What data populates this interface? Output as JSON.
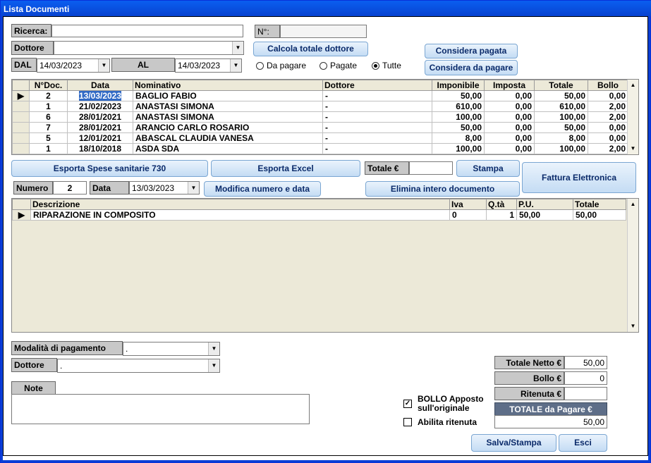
{
  "window": {
    "title": "Lista Documenti"
  },
  "search": {
    "ricerca_label": "Ricerca:",
    "ricerca_value": "",
    "numero_label": "N°:",
    "numero_value": "",
    "dottore_label": "Dottore",
    "dottore_value": "",
    "dal_label": "DAL",
    "dal_value": "14/03/2023",
    "al_label": "AL",
    "al_value": "14/03/2023"
  },
  "buttons": {
    "calcola": "Calcola totale dottore",
    "considera_pagata": "Considera pagata",
    "considera_da_pagare": "Considera da pagare",
    "esporta_730": "Esporta Spese sanitarie 730",
    "esporta_excel": "Esporta Excel",
    "stampa": "Stampa",
    "fattura": "Fattura Elettronica",
    "modifica": "Modifica numero e data",
    "elimina": "Elimina intero documento",
    "salva": "Salva/Stampa",
    "esci": "Esci"
  },
  "filter": {
    "options": [
      "Da pagare",
      "Pagate",
      "Tutte"
    ],
    "selected": "Tutte"
  },
  "docs": {
    "headers": [
      "N°Doc.",
      "Data",
      "Nominativo",
      "Dottore",
      "Imponibile",
      "Imposta",
      "Totale",
      "Bollo"
    ],
    "rows": [
      [
        "2",
        "13/03/2023",
        "BAGLIO FABIO",
        "-",
        "50,00",
        "0,00",
        "50,00",
        "0,00"
      ],
      [
        "1",
        "21/02/2023",
        "ANASTASI SIMONA",
        "-",
        "610,00",
        "0,00",
        "610,00",
        "2,00"
      ],
      [
        "6",
        "28/01/2021",
        "ANASTASI SIMONA",
        "-",
        "100,00",
        "0,00",
        "100,00",
        "2,00"
      ],
      [
        "7",
        "28/01/2021",
        "ARANCIO CARLO ROSARIO",
        "-",
        "50,00",
        "0,00",
        "50,00",
        "0,00"
      ],
      [
        "5",
        "12/01/2021",
        "ABASCAL CLAUDIA VANESA",
        "-",
        "8,00",
        "0,00",
        "8,00",
        "0,00"
      ],
      [
        "1",
        "18/10/2018",
        "ASDA SDA",
        "-",
        "100,00",
        "0,00",
        "100,00",
        "2,00"
      ]
    ]
  },
  "totale": {
    "label": "Totale €",
    "value": ""
  },
  "numero": {
    "label": "Numero",
    "value": "2",
    "data_label": "Data",
    "data_value": "13/03/2023"
  },
  "items": {
    "headers": [
      "Descrizione",
      "Iva",
      "Q.tà",
      "P.U.",
      "Totale"
    ],
    "rows": [
      [
        "RIPARAZIONE IN COMPOSITO",
        "0",
        "1",
        "50,00",
        "50,00"
      ]
    ]
  },
  "pagamento": {
    "label": "Modalità di pagamento",
    "value": ".",
    "dottore_label": "Dottore",
    "dottore_value": "."
  },
  "note": {
    "label": "Note",
    "value": ""
  },
  "checks": {
    "bollo_line1": "BOLLO Apposto",
    "bollo_line2": "sull'originale",
    "bollo_checked": true,
    "ritenuta": "Abilita ritenuta",
    "ritenuta_checked": false
  },
  "summary": {
    "netto_label": "Totale Netto €",
    "netto_value": "50,00",
    "bollo_label": "Bollo €",
    "bollo_value": "0",
    "ritenuta_label": "Ritenuta €",
    "ritenuta_value": "",
    "pagare_label": "TOTALE da Pagare €",
    "pagare_value": "50,00"
  }
}
